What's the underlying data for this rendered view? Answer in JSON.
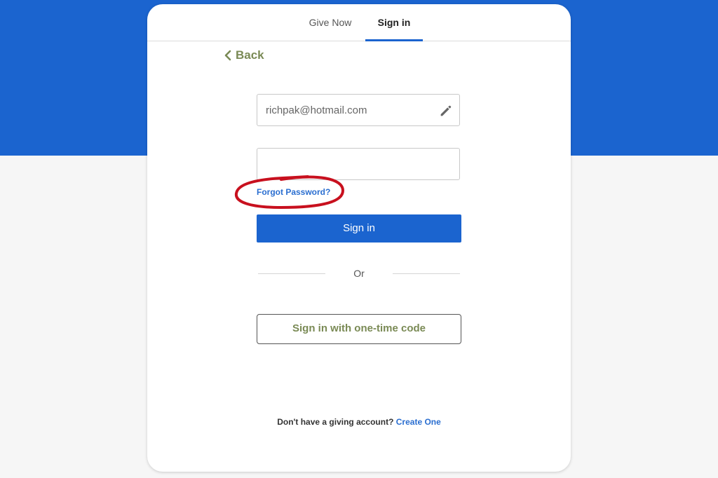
{
  "tabs": {
    "give_now": "Give Now",
    "sign_in": "Sign in"
  },
  "back": {
    "label": "Back",
    "icon": "chevron-left-icon"
  },
  "email_field": {
    "value": "richpak@hotmail.com",
    "icon": "pencil-icon"
  },
  "password_field": {
    "value": ""
  },
  "forgot_password": "Forgot Password?",
  "signin_button": "Sign in",
  "divider_label": "Or",
  "otc_button": "Sign in with one-time code",
  "footer": {
    "prompt": "Don't have a giving account?",
    "link": "Create One"
  },
  "colors": {
    "brand_blue": "#1b64cf",
    "accent_olive": "#7a8a55",
    "link_blue": "#2a6ed0",
    "annotation_red": "#c8101e"
  }
}
